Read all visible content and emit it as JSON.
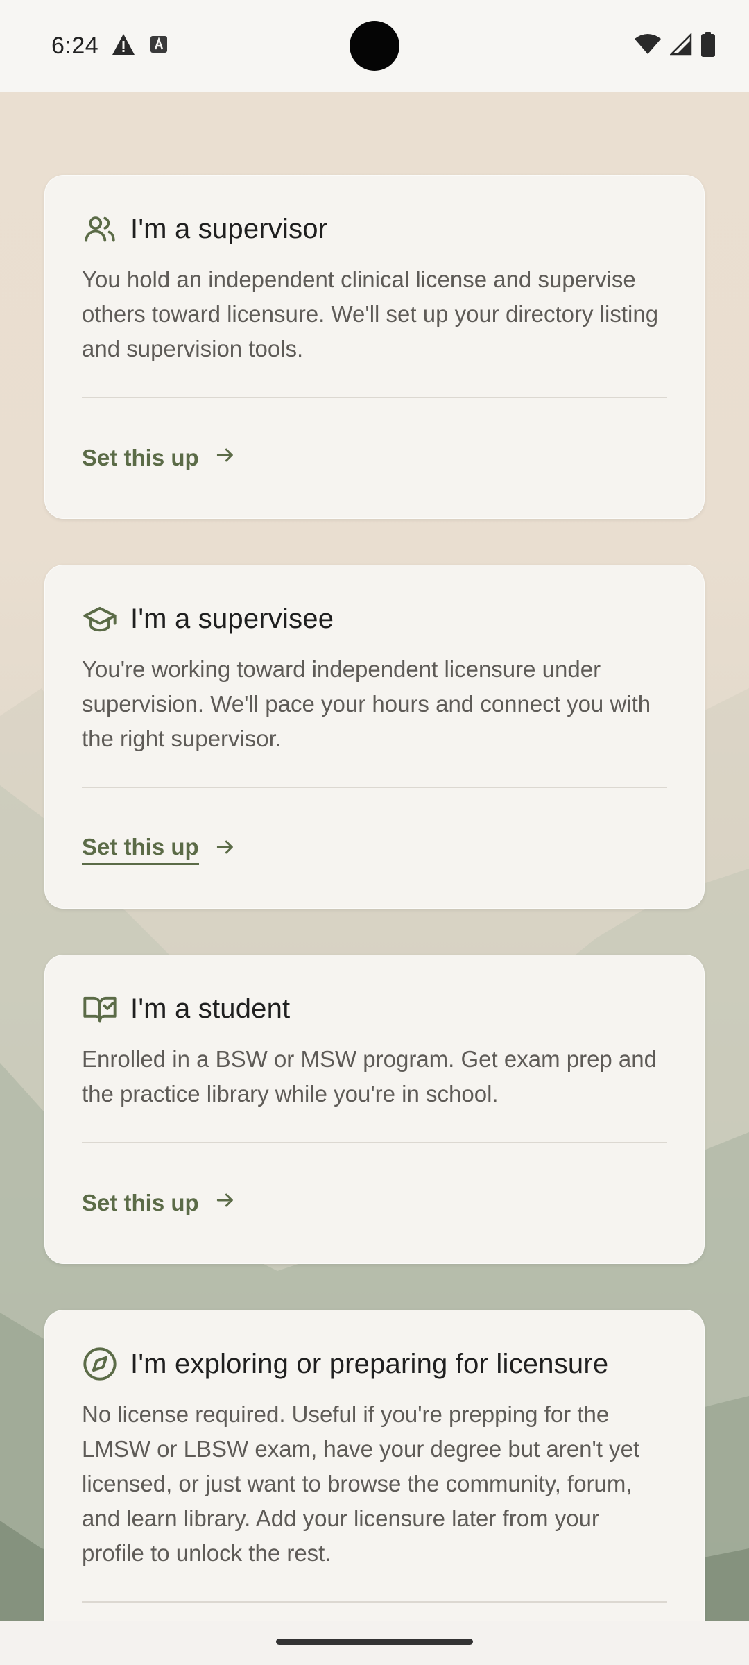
{
  "status_bar": {
    "time": "6:24",
    "left_icons": [
      "warning-icon",
      "text-a-icon"
    ],
    "right_icons": [
      "wifi-icon",
      "cellular-icon",
      "battery-icon"
    ]
  },
  "colors": {
    "accent": "#5b6b47",
    "card_bg": "#f6f4f0",
    "title": "#1f1f1f",
    "body": "#5e5b57"
  },
  "cards": [
    {
      "icon": "users-icon",
      "title": "I'm a supervisor",
      "description": "You hold an independent clinical license and supervise others toward licensure. We'll set up your directory listing and supervision tools.",
      "cta": "Set this up"
    },
    {
      "icon": "graduation-cap-icon",
      "title": "I'm a supervisee",
      "description": "You're working toward independent licensure under supervision. We'll pace your hours and connect you with the right supervisor.",
      "cta": "Set this up"
    },
    {
      "icon": "book-check-icon",
      "title": "I'm a student",
      "description": "Enrolled in a BSW or MSW program. Get exam prep and the practice library while you're in school.",
      "cta": "Set this up"
    },
    {
      "icon": "compass-icon",
      "title": "I'm exploring or preparing for licensure",
      "description": "No license required. Useful if you're prepping for the LMSW or LBSW exam, have your degree but aren't yet licensed, or just want to browse the community, forum, and learn library. Add your licensure later from your profile to unlock the rest."
    }
  ]
}
